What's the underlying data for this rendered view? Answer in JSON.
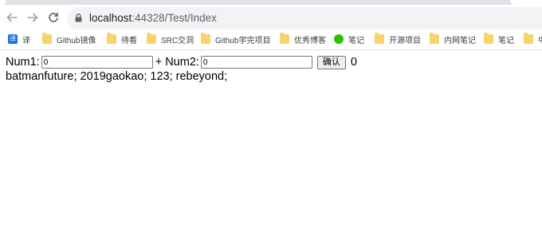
{
  "browser": {
    "url_host": "localhost",
    "url_path": ":44328/Test/Index",
    "bookmarks": [
      {
        "label": "译",
        "icon": "translate-icon"
      },
      {
        "label": "Github镜像",
        "icon": "folder-icon"
      },
      {
        "label": "待看",
        "icon": "folder-icon"
      },
      {
        "label": "SRC交洞",
        "icon": "folder-icon"
      },
      {
        "label": "Github学完项目",
        "icon": "folder-icon"
      },
      {
        "label": "优秀博客",
        "icon": "folder-icon"
      },
      {
        "label": "笔记",
        "icon": "wechat-icon"
      },
      {
        "label": "开源项目",
        "icon": "folder-icon"
      },
      {
        "label": "内网笔记",
        "icon": "folder-icon"
      },
      {
        "label": "笔记",
        "icon": "folder-icon"
      },
      {
        "label": "中",
        "icon": "folder-icon"
      }
    ]
  },
  "form": {
    "num1_label": "Num1:",
    "num1_value": "0",
    "plus": "+",
    "num2_label": "Num2:",
    "num2_value": "0",
    "confirm_label": "确认",
    "result": "0"
  },
  "output_line": "batmanfuture; 2019gaokao; 123; rebeyond;"
}
